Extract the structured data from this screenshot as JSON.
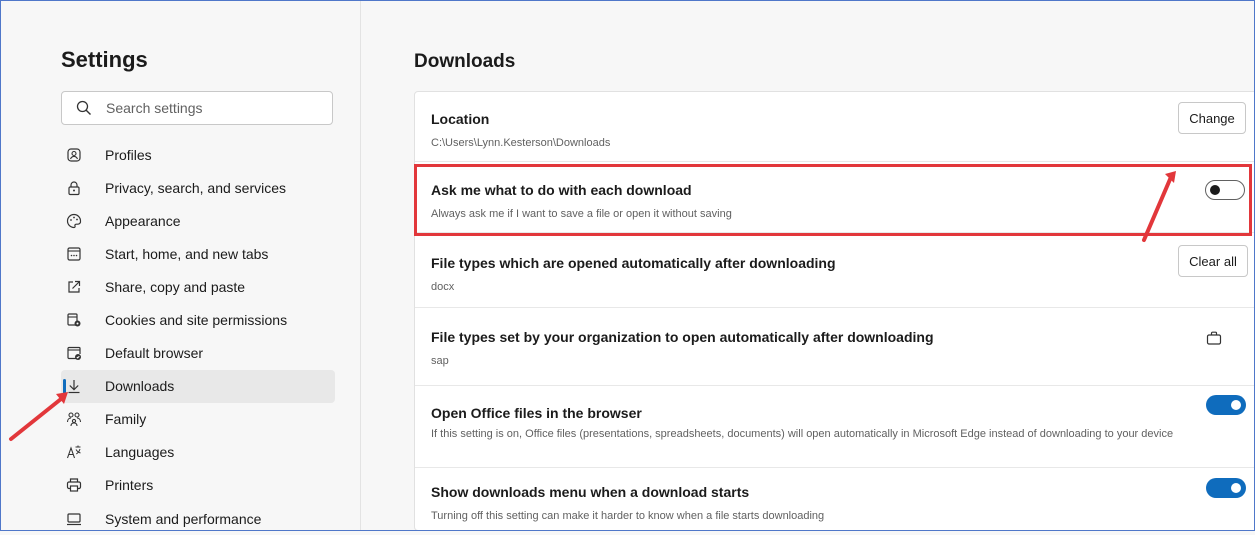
{
  "sidebar": {
    "title": "Settings",
    "search_placeholder": "Search settings",
    "items": [
      {
        "label": "Profiles",
        "icon": "profile-icon"
      },
      {
        "label": "Privacy, search, and services",
        "icon": "lock-icon"
      },
      {
        "label": "Appearance",
        "icon": "appearance-icon"
      },
      {
        "label": "Start, home, and new tabs",
        "icon": "start-icon"
      },
      {
        "label": "Share, copy and paste",
        "icon": "share-icon"
      },
      {
        "label": "Cookies and site permissions",
        "icon": "cookies-icon"
      },
      {
        "label": "Default browser",
        "icon": "default-browser-icon"
      },
      {
        "label": "Downloads",
        "icon": "download-icon",
        "active": true
      },
      {
        "label": "Family",
        "icon": "family-icon"
      },
      {
        "label": "Languages",
        "icon": "languages-icon"
      },
      {
        "label": "Printers",
        "icon": "printer-icon"
      },
      {
        "label": "System and performance",
        "icon": "system-icon"
      }
    ]
  },
  "main": {
    "title": "Downloads",
    "location": {
      "title": "Location",
      "path": "C:\\Users\\Lynn.Kesterson\\Downloads",
      "button": "Change"
    },
    "ask": {
      "title": "Ask me what to do with each download",
      "desc": "Always ask me if I want to save a file or open it without saving",
      "enabled": false
    },
    "auto_open": {
      "title": "File types which are opened automatically after downloading",
      "value": "docx",
      "button": "Clear all"
    },
    "org_open": {
      "title": "File types set by your organization to open automatically after downloading",
      "value": "sap",
      "icon": "briefcase-icon"
    },
    "office": {
      "title": "Open Office files in the browser",
      "desc": "If this setting is on, Office files (presentations, spreadsheets, documents) will open automatically in Microsoft Edge instead of downloading to your device",
      "enabled": true
    },
    "menu": {
      "title": "Show downloads menu when a download starts",
      "desc": "Turning off this setting can make it harder to know when a file starts downloading",
      "enabled": true
    }
  },
  "colors": {
    "accent": "#0f6cbd",
    "annotation": "#e2373b"
  }
}
